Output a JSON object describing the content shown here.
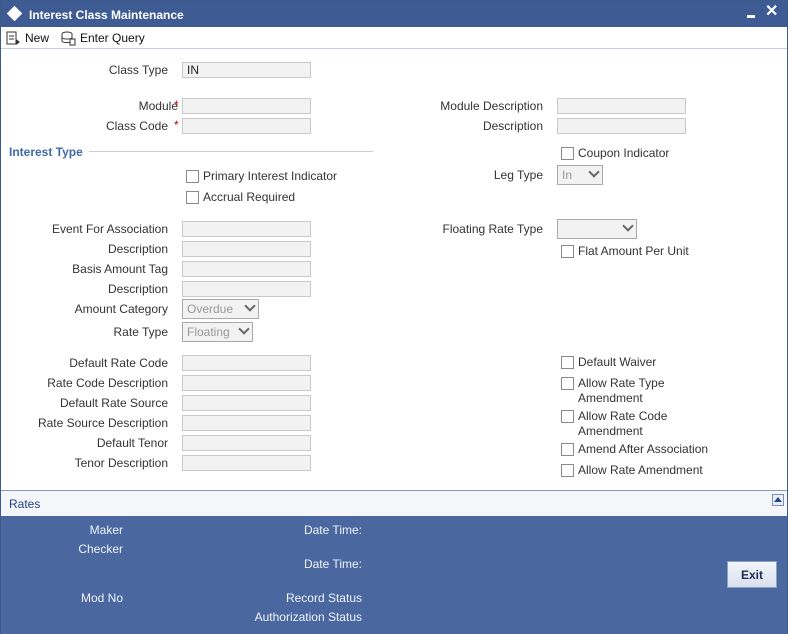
{
  "window": {
    "title": "Interest Class Maintenance"
  },
  "toolbar": {
    "new_label": "New",
    "enter_query_label": "Enter Query"
  },
  "form": {
    "class_type": {
      "label": "Class Type",
      "value": "IN"
    },
    "module": {
      "label": "Module",
      "value": ""
    },
    "class_code": {
      "label": "Class Code",
      "value": ""
    },
    "module_description": {
      "label": "Module Description",
      "value": ""
    },
    "description": {
      "label": "Description",
      "value": ""
    }
  },
  "interest_type": {
    "title": "Interest Type",
    "primary_interest_indicator": "Primary Interest Indicator",
    "accrual_required": "Accrual Required",
    "coupon_indicator": "Coupon Indicator",
    "leg_type": {
      "label": "Leg Type",
      "value": "In"
    },
    "event_for_association": "Event For Association",
    "event_description": "Description",
    "basis_amount_tag": "Basis Amount Tag",
    "basis_description": "Description",
    "amount_category": {
      "label": "Amount Category",
      "value": "Overdue"
    },
    "rate_type": {
      "label": "Rate Type",
      "value": "Floating"
    },
    "floating_rate_type": {
      "label": "Floating Rate Type",
      "value": ""
    },
    "flat_amount_per_unit": "Flat Amount Per Unit",
    "default_rate_code": "Default Rate Code",
    "rate_code_description": "Rate Code Description",
    "default_rate_source": "Default Rate Source",
    "rate_source_description": "Rate Source Description",
    "default_tenor": "Default Tenor",
    "tenor_description": "Tenor Description",
    "default_waiver": "Default Waiver",
    "allow_rate_type_amendment_1": "Allow Rate Type",
    "allow_rate_type_amendment_2": "Amendment",
    "allow_rate_code_amendment_1": "Allow Rate Code",
    "allow_rate_code_amendment_2": "Amendment",
    "amend_after_association": "Amend After Association",
    "allow_rate_amendment": "Allow Rate Amendment"
  },
  "tabs": {
    "rates": "Rates"
  },
  "footer": {
    "maker": "Maker",
    "checker": "Checker",
    "date_time_1": "Date Time:",
    "date_time_2": "Date Time:",
    "mod_no": "Mod No",
    "record_status": "Record Status",
    "authorization_status": "Authorization Status",
    "exit_label": "Exit"
  }
}
